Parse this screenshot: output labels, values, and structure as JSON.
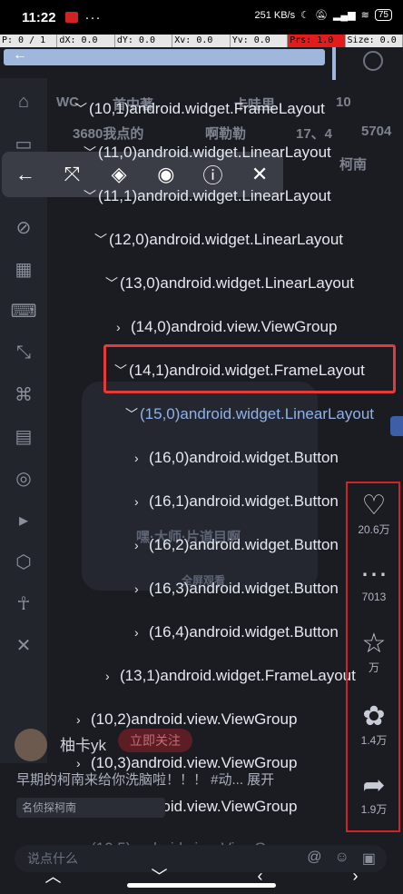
{
  "status_bar": {
    "time": "11:22",
    "more": "···",
    "net_speed": "251 KB/s",
    "battery": "75"
  },
  "pointer_location": [
    "P: 0 / 1",
    "dX: 0.0",
    "dY: 0.0",
    "Xv: 0.0",
    "Yv: 0.0",
    "Prs: 1.0",
    "Size: 0.0"
  ],
  "background_app": {
    "header_fragments": [
      "WC",
      "首中著",
      "卡哇里",
      "10",
      "3680我点的",
      "啊勒勒",
      "17、4",
      "5704",
      "柯南"
    ],
    "video_title": "嘿·大师·片道目啊",
    "video_tag": "全屏观看",
    "author": "柚卡yk",
    "follow": "立即关注",
    "description": "早期的柯南来给你洗脑啦！！！ #动... 展开",
    "tag": "名侦探柯南",
    "comment_placeholder": "说点什么"
  },
  "actions": [
    {
      "icon": "heart-icon",
      "label": "20.6万"
    },
    {
      "icon": "comment-icon",
      "label": "7013"
    },
    {
      "icon": "star-icon",
      "label": "万"
    },
    {
      "icon": "reward-icon",
      "label": "1.4万"
    },
    {
      "icon": "share-icon",
      "label": "1.9万"
    }
  ],
  "toolbar": {
    "icons": [
      "back-arrow-icon",
      "expand-icon",
      "layers-icon",
      "target-icon",
      "info-icon",
      "close-icon"
    ]
  },
  "tree": [
    {
      "label": "(10,1)android.widget.FrameLayout",
      "expanded": true
    },
    {
      "label": "(11,0)android.widget.LinearLayout",
      "expanded": true
    },
    {
      "label": "(11,1)android.widget.LinearLayout",
      "expanded": true
    },
    {
      "label": "(12,0)android.widget.LinearLayout",
      "expanded": true
    },
    {
      "label": "(13,0)android.widget.LinearLayout",
      "expanded": true
    },
    {
      "label": "(14,0)android.view.ViewGroup",
      "expanded": false
    },
    {
      "label": "(14,1)android.widget.FrameLayout",
      "expanded": true
    },
    {
      "label": "(15,0)android.widget.LinearLayout",
      "expanded": true
    },
    {
      "label": "(16,0)android.widget.Button",
      "expanded": false
    },
    {
      "label": "(16,1)android.widget.Button",
      "expanded": false
    },
    {
      "label": "(16,2)android.widget.Button",
      "expanded": false
    },
    {
      "label": "(16,3)android.widget.Button",
      "expanded": false
    },
    {
      "label": "(16,4)android.widget.Button",
      "expanded": false
    },
    {
      "label": "(13,1)android.widget.FrameLayout",
      "expanded": false
    },
    {
      "label": "(10,2)android.view.ViewGroup",
      "expanded": false
    },
    {
      "label": "(10,3)android.view.ViewGroup",
      "expanded": false
    },
    {
      "label": "(10,4)android.view.ViewGroup",
      "expanded": false
    },
    {
      "label": "(10,5)android.view.ViewGroup",
      "expanded": false
    }
  ]
}
